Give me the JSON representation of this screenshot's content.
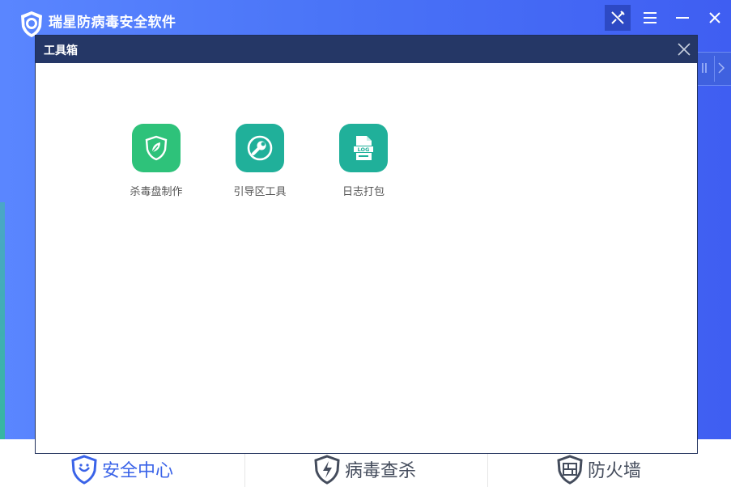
{
  "app": {
    "title": "瑞星防病毒安全软件"
  },
  "colors": {
    "accent_blue": "#4a74f7",
    "dialog_header": "#253766",
    "tool_green": "#2ec27a",
    "tool_teal": "#20b09a",
    "nav_active": "#3a63e8",
    "nav_inactive": "#444c5c"
  },
  "window_controls": {
    "tools": "tools-icon",
    "menu": "menu-icon",
    "minimize": "minimize-icon",
    "close": "close-icon"
  },
  "dialog": {
    "title": "工具箱",
    "tools": [
      {
        "label": "杀毒盘制作",
        "icon": "shield-leaf-icon"
      },
      {
        "label": "引导区工具",
        "icon": "wrench-icon"
      },
      {
        "label": "日志打包",
        "icon": "log-file-icon"
      }
    ]
  },
  "bottom_nav": {
    "items": [
      {
        "label": "安全中心",
        "icon": "shield-lion-icon",
        "active": true
      },
      {
        "label": "病毒查杀",
        "icon": "shield-bolt-icon",
        "active": false
      },
      {
        "label": "防火墙",
        "icon": "firewall-icon",
        "active": false
      }
    ]
  }
}
